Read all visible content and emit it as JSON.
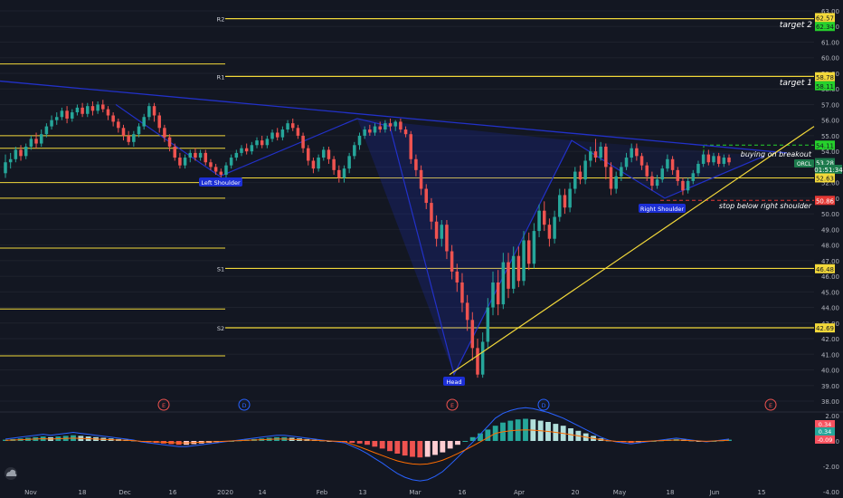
{
  "chart_data": {
    "type": "candlestick",
    "x_ticks": [
      "Nov",
      "18",
      "Dec",
      "16",
      "2020",
      "14",
      "Feb",
      "13",
      "Mar",
      "16",
      "Apr",
      "20",
      "May",
      "18",
      "Jun",
      "15"
    ],
    "price_ticks": [
      "63.00",
      "62.00",
      "61.00",
      "60.00",
      "59.00",
      "58.00",
      "57.00",
      "56.00",
      "55.00",
      "54.00",
      "53.00",
      "52.00",
      "51.00",
      "50.00",
      "49.00",
      "48.00",
      "47.00",
      "46.00",
      "45.00",
      "44.00",
      "43.00",
      "42.00",
      "41.00",
      "40.00",
      "39.00",
      "38.00"
    ],
    "ylim": [
      38.0,
      63.0
    ],
    "pivots": [
      {
        "label": "R2",
        "value": 62.5
      },
      {
        "label": "R1",
        "value": 58.8
      },
      {
        "label": "S1",
        "value": 46.5
      },
      {
        "label": "S2",
        "value": 42.7
      }
    ],
    "right_tags": [
      {
        "text": "62.57",
        "value": 62.57,
        "color": "#f2d83a"
      },
      {
        "text": "62.34",
        "value": 62.0,
        "color": "#26d12c"
      },
      {
        "text": "58.78",
        "value": 58.78,
        "color": "#f2d83a"
      },
      {
        "text": "58.11",
        "value": 58.2,
        "color": "#26d12c"
      },
      {
        "text": "54.11",
        "value": 54.4,
        "color": "#26d12c"
      },
      {
        "text": "53.28",
        "value": 53.28,
        "color": "#1c7a4c"
      },
      {
        "text": "01:51:34",
        "value": 52.85,
        "color": "#1c7a4c"
      },
      {
        "text": "52.63",
        "value": 52.3,
        "color": "#f2d83a"
      },
      {
        "text": "50.86",
        "value": 50.86,
        "color": "#e53935"
      },
      {
        "text": "46.48",
        "value": 46.48,
        "color": "#f2d83a"
      },
      {
        "text": "42.69",
        "value": 42.69,
        "color": "#f2d83a"
      }
    ],
    "annotations": {
      "target_2": "target 2",
      "target_1": "target 1",
      "buying": "buying on breakout",
      "stop": "stop below right shoulder",
      "left_shoulder": "Left Shoulder",
      "right_shoulder": "Right Shoulder",
      "head": "Head",
      "symbol_badge": "ORCL"
    },
    "event_markers": [
      {
        "type": "E",
        "x_pos": "Dec 10"
      },
      {
        "type": "D",
        "x_pos": "Jan 7"
      },
      {
        "type": "E",
        "x_pos": "Mar 12"
      },
      {
        "type": "D",
        "x_pos": "Apr 14"
      },
      {
        "type": "E",
        "x_pos": "Jun 12"
      }
    ],
    "macd_ticks": [
      "2.00",
      "0.00",
      "-2.00",
      "-4.00"
    ],
    "macd_tags": [
      {
        "text": "0.34",
        "color": "#f7525f"
      },
      {
        "text": "0.34",
        "color": "#26a69a"
      },
      {
        "text": "-0.09",
        "color": "#f7525f"
      }
    ],
    "candles": [
      [
        52.6,
        53.3,
        53.8,
        52.3
      ],
      [
        53.3,
        53.5,
        53.9,
        52.9
      ],
      [
        53.5,
        54.1,
        54.3,
        53.3
      ],
      [
        54.1,
        53.7,
        54.4,
        53.4
      ],
      [
        53.7,
        54.3,
        54.5,
        53.5
      ],
      [
        54.3,
        54.8,
        55.0,
        54.1
      ],
      [
        54.8,
        54.5,
        55.2,
        54.2
      ],
      [
        54.5,
        55.1,
        55.4,
        54.3
      ],
      [
        55.1,
        55.6,
        55.8,
        54.9
      ],
      [
        55.6,
        56.0,
        56.3,
        55.4
      ],
      [
        56.0,
        56.2,
        56.5,
        55.7
      ],
      [
        56.2,
        56.6,
        56.8,
        56.0
      ],
      [
        56.6,
        56.1,
        56.9,
        55.8
      ],
      [
        56.1,
        56.5,
        56.7,
        55.9
      ],
      [
        56.5,
        56.8,
        57.0,
        56.3
      ],
      [
        56.8,
        56.4,
        57.1,
        56.2
      ],
      [
        56.4,
        56.9,
        57.1,
        56.2
      ],
      [
        56.9,
        56.6,
        57.2,
        56.3
      ],
      [
        56.6,
        57.0,
        57.2,
        56.4
      ],
      [
        57.0,
        56.7,
        57.3,
        56.5
      ],
      [
        56.7,
        56.3,
        56.9,
        56.0
      ],
      [
        56.3,
        55.9,
        56.5,
        55.6
      ],
      [
        55.9,
        55.5,
        56.1,
        55.2
      ],
      [
        55.5,
        55.0,
        55.7,
        54.7
      ],
      [
        55.0,
        54.6,
        55.3,
        54.4
      ],
      [
        54.6,
        55.1,
        55.3,
        54.3
      ],
      [
        55.1,
        55.6,
        55.8,
        54.9
      ],
      [
        55.6,
        56.2,
        56.4,
        55.4
      ],
      [
        56.2,
        56.9,
        57.1,
        56.0
      ],
      [
        56.9,
        56.3,
        57.1,
        55.9
      ],
      [
        56.3,
        55.5,
        56.5,
        55.2
      ],
      [
        55.5,
        54.9,
        55.7,
        54.6
      ],
      [
        54.9,
        54.3,
        55.1,
        54.0
      ],
      [
        54.3,
        53.6,
        54.5,
        53.4
      ],
      [
        53.6,
        53.1,
        53.9,
        52.9
      ],
      [
        53.1,
        53.6,
        53.8,
        52.9
      ],
      [
        53.6,
        53.9,
        54.1,
        53.3
      ],
      [
        53.9,
        53.6,
        54.2,
        53.4
      ],
      [
        53.6,
        53.9,
        54.1,
        53.4
      ],
      [
        53.9,
        53.3,
        54.1,
        53.1
      ],
      [
        53.3,
        53.0,
        53.5,
        52.8
      ],
      [
        53.0,
        52.7,
        53.2,
        52.5
      ],
      [
        52.7,
        52.5,
        52.9,
        52.3
      ],
      [
        52.5,
        53.1,
        53.3,
        52.3
      ],
      [
        53.1,
        53.6,
        53.8,
        52.9
      ],
      [
        53.6,
        53.9,
        54.1,
        53.4
      ],
      [
        53.9,
        54.2,
        54.4,
        53.7
      ],
      [
        54.2,
        54.0,
        54.5,
        53.8
      ],
      [
        54.0,
        54.4,
        54.6,
        53.8
      ],
      [
        54.4,
        54.7,
        54.9,
        54.2
      ],
      [
        54.7,
        54.4,
        55.0,
        54.2
      ],
      [
        54.4,
        54.8,
        55.0,
        54.2
      ],
      [
        54.8,
        55.2,
        55.4,
        54.6
      ],
      [
        55.2,
        54.9,
        55.5,
        54.7
      ],
      [
        54.9,
        55.4,
        55.6,
        54.7
      ],
      [
        55.4,
        55.8,
        56.0,
        55.2
      ],
      [
        55.8,
        55.5,
        56.1,
        55.3
      ],
      [
        55.5,
        55.0,
        55.7,
        54.8
      ],
      [
        55.0,
        54.2,
        55.2,
        53.9
      ],
      [
        54.2,
        53.4,
        54.4,
        53.1
      ],
      [
        53.4,
        52.9,
        53.6,
        52.6
      ],
      [
        52.9,
        53.6,
        53.8,
        52.7
      ],
      [
        53.6,
        54.1,
        54.3,
        53.4
      ],
      [
        54.1,
        53.5,
        54.3,
        53.2
      ],
      [
        53.5,
        52.8,
        53.7,
        52.5
      ],
      [
        52.8,
        52.3,
        53.1,
        52.0
      ],
      [
        52.3,
        52.9,
        53.1,
        52.0
      ],
      [
        52.9,
        53.7,
        53.9,
        52.6
      ],
      [
        53.7,
        54.4,
        54.6,
        53.5
      ],
      [
        54.4,
        55.0,
        55.2,
        54.1
      ],
      [
        55.0,
        55.4,
        55.6,
        54.8
      ],
      [
        55.4,
        55.2,
        55.7,
        55.0
      ],
      [
        55.2,
        55.6,
        55.8,
        55.0
      ],
      [
        55.6,
        55.4,
        55.9,
        55.2
      ],
      [
        55.4,
        55.8,
        56.0,
        55.2
      ],
      [
        55.8,
        55.6,
        56.1,
        55.3
      ],
      [
        55.6,
        55.9,
        56.0,
        55.3
      ],
      [
        55.9,
        55.4,
        56.1,
        55.2
      ],
      [
        55.4,
        55.1,
        55.6,
        54.9
      ],
      [
        55.1,
        53.5,
        55.3,
        53.2
      ],
      [
        53.5,
        52.8,
        53.8,
        52.4
      ],
      [
        52.8,
        51.6,
        53.1,
        51.2
      ],
      [
        51.6,
        50.7,
        51.9,
        50.3
      ],
      [
        50.7,
        49.5,
        51.0,
        49.0
      ],
      [
        49.5,
        48.4,
        49.9,
        47.9
      ],
      [
        48.4,
        49.3,
        49.6,
        47.9
      ],
      [
        49.3,
        47.6,
        49.6,
        47.1
      ],
      [
        47.6,
        46.3,
        48.0,
        45.8
      ],
      [
        46.3,
        45.6,
        46.8,
        45.0
      ],
      [
        45.6,
        44.3,
        46.2,
        43.7
      ],
      [
        44.3,
        43.2,
        44.8,
        42.5
      ],
      [
        43.2,
        41.4,
        43.7,
        40.6
      ],
      [
        41.4,
        39.7,
        42.0,
        39.5
      ],
      [
        39.7,
        41.8,
        42.4,
        39.5
      ],
      [
        41.8,
        44.0,
        44.6,
        41.4
      ],
      [
        44.0,
        45.6,
        46.3,
        43.5
      ],
      [
        45.6,
        44.2,
        46.4,
        43.5
      ],
      [
        44.2,
        46.9,
        47.5,
        43.9
      ],
      [
        46.9,
        45.2,
        47.5,
        44.6
      ],
      [
        45.2,
        47.3,
        47.9,
        44.9
      ],
      [
        47.3,
        45.7,
        47.9,
        45.3
      ],
      [
        45.7,
        48.3,
        48.9,
        45.4
      ],
      [
        48.3,
        46.8,
        48.8,
        46.4
      ],
      [
        46.8,
        48.9,
        49.4,
        46.5
      ],
      [
        48.9,
        50.2,
        50.6,
        48.5
      ],
      [
        50.2,
        49.3,
        50.8,
        48.9
      ],
      [
        49.3,
        48.4,
        49.7,
        47.9
      ],
      [
        48.4,
        49.8,
        50.2,
        48.1
      ],
      [
        49.8,
        51.2,
        51.6,
        49.5
      ],
      [
        51.2,
        50.4,
        51.6,
        50.0
      ],
      [
        50.4,
        51.6,
        52.0,
        50.1
      ],
      [
        51.6,
        52.7,
        53.0,
        51.3
      ],
      [
        52.7,
        52.2,
        53.1,
        51.9
      ],
      [
        52.2,
        53.4,
        53.8,
        51.9
      ],
      [
        53.4,
        54.0,
        54.3,
        53.0
      ],
      [
        54.0,
        53.6,
        54.8,
        53.3
      ],
      [
        53.6,
        54.3,
        54.6,
        53.4
      ],
      [
        54.3,
        53.0,
        54.5,
        52.2
      ],
      [
        53.0,
        51.6,
        53.3,
        51.2
      ],
      [
        51.6,
        52.4,
        52.7,
        51.3
      ],
      [
        52.4,
        53.0,
        53.3,
        52.1
      ],
      [
        53.0,
        53.6,
        53.9,
        52.8
      ],
      [
        53.6,
        54.2,
        54.5,
        53.3
      ],
      [
        54.2,
        53.7,
        54.5,
        53.4
      ],
      [
        53.7,
        53.1,
        53.9,
        52.8
      ],
      [
        53.1,
        52.4,
        53.3,
        52.1
      ],
      [
        52.4,
        51.8,
        52.7,
        51.5
      ],
      [
        51.8,
        52.2,
        52.5,
        51.6
      ],
      [
        52.2,
        52.9,
        53.1,
        52.0
      ],
      [
        52.9,
        53.5,
        53.8,
        52.7
      ],
      [
        53.5,
        52.8,
        53.7,
        52.5
      ],
      [
        52.8,
        52.1,
        53.0,
        51.8
      ],
      [
        52.1,
        51.5,
        52.3,
        51.2
      ],
      [
        51.5,
        52.1,
        52.3,
        51.3
      ],
      [
        52.1,
        52.6,
        52.8,
        51.9
      ],
      [
        52.6,
        53.2,
        53.4,
        52.4
      ],
      [
        53.2,
        53.8,
        54.0,
        53.0
      ],
      [
        53.8,
        53.3,
        54.1,
        53.1
      ],
      [
        53.3,
        53.7,
        53.9,
        53.1
      ],
      [
        53.7,
        53.2,
        53.9,
        53.0
      ],
      [
        53.2,
        53.6,
        53.8,
        53.0
      ],
      [
        53.6,
        53.3,
        53.8,
        53.1
      ]
    ],
    "macd_hist": [
      0.1,
      0.15,
      0.2,
      0.25,
      0.3,
      0.35,
      0.3,
      0.35,
      0.4,
      0.45,
      0.4,
      0.35,
      0.3,
      0.25,
      0.2,
      0.15,
      0.1,
      0.05,
      -0.05,
      -0.1,
      -0.15,
      -0.2,
      -0.25,
      -0.3,
      -0.3,
      -0.25,
      -0.2,
      -0.15,
      -0.1,
      -0.05,
      0.0,
      0.05,
      0.1,
      0.15,
      0.2,
      0.25,
      0.3,
      0.3,
      0.25,
      0.2,
      0.15,
      0.1,
      0.05,
      0.0,
      -0.05,
      -0.1,
      -0.15,
      -0.2,
      -0.3,
      -0.45,
      -0.6,
      -0.8,
      -1.0,
      -1.15,
      -1.25,
      -1.3,
      -1.25,
      -1.1,
      -0.9,
      -0.6,
      -0.3,
      0.0,
      0.3,
      0.6,
      0.9,
      1.2,
      1.45,
      1.6,
      1.7,
      1.75,
      1.7,
      1.6,
      1.5,
      1.35,
      1.2,
      1.0,
      0.8,
      0.6,
      0.4,
      0.2,
      0.05,
      -0.05,
      -0.1,
      -0.15,
      -0.1,
      -0.05,
      0.0,
      0.05,
      0.1,
      0.15,
      0.1,
      0.05,
      0.0,
      -0.05,
      0.0,
      0.05,
      0.1
    ]
  }
}
